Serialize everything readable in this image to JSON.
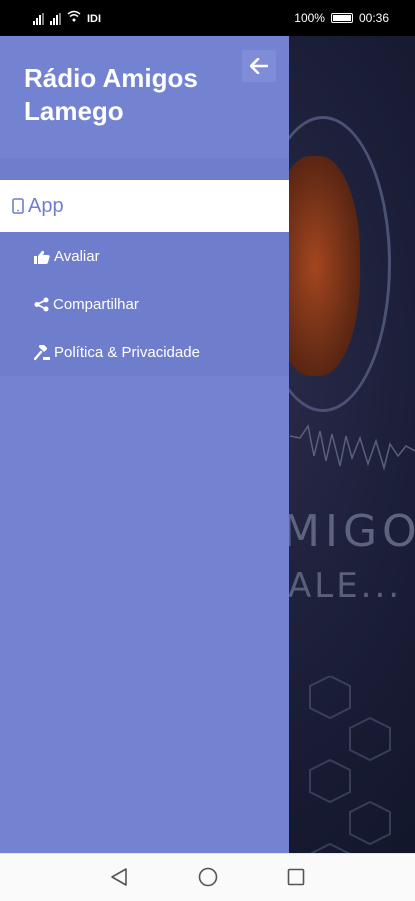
{
  "status_bar": {
    "battery_percent": "100%",
    "time": "00:36"
  },
  "background": {
    "text_line1": "MIGOS",
    "text_line2": "ALE..."
  },
  "drawer": {
    "title": "Rádio Amigos Lamego",
    "back_icon": "arrow-left-icon",
    "menu": {
      "active_item": {
        "label": "App",
        "icon": "tablet-icon"
      },
      "items": [
        {
          "label": "Avaliar",
          "icon": "thumbs-up-icon"
        },
        {
          "label": "Compartilhar",
          "icon": "share-icon"
        },
        {
          "label": "Política & Privacidade",
          "icon": "gavel-icon"
        }
      ]
    }
  },
  "nav_bar": {
    "buttons": [
      "back-triangle-icon",
      "home-circle-icon",
      "recents-square-icon"
    ]
  },
  "colors": {
    "drawer_bg": "#7382d1",
    "menu_bg": "#6e7dcc",
    "active_text": "#6f7ecf",
    "background_dark": "#181b33"
  }
}
